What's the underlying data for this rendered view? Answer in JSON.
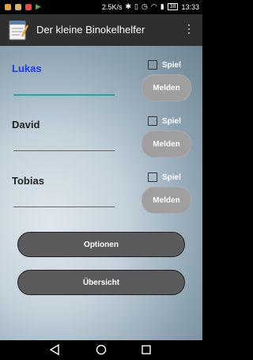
{
  "status_bar": {
    "network_speed": "2.5K/s",
    "battery": "38",
    "time": "13:33"
  },
  "app_bar": {
    "title": "Der kleine Binokelhelfer",
    "overflow_icon": "more-vert-icon",
    "app_icon": "notepad-icon"
  },
  "players": [
    {
      "name": "Lukas",
      "active": true,
      "checkbox_label": "Spiel",
      "button_label": "Melden"
    },
    {
      "name": "David",
      "active": false,
      "checkbox_label": "Spiel",
      "button_label": "Melden"
    },
    {
      "name": "Tobias",
      "active": false,
      "checkbox_label": "Spiel",
      "button_label": "Melden"
    }
  ],
  "buttons": {
    "optionen": "Optionen",
    "uebersicht": "Übersicht"
  },
  "nav": {
    "back": "back-icon",
    "home": "home-icon",
    "recents": "recents-icon"
  },
  "colors": {
    "active_name": "#1a3cf5",
    "active_underline": "#22a89b",
    "app_bar": "#2f2f2f",
    "melden_button": "#9f9f9f",
    "main_button": "#5b5b5b"
  }
}
